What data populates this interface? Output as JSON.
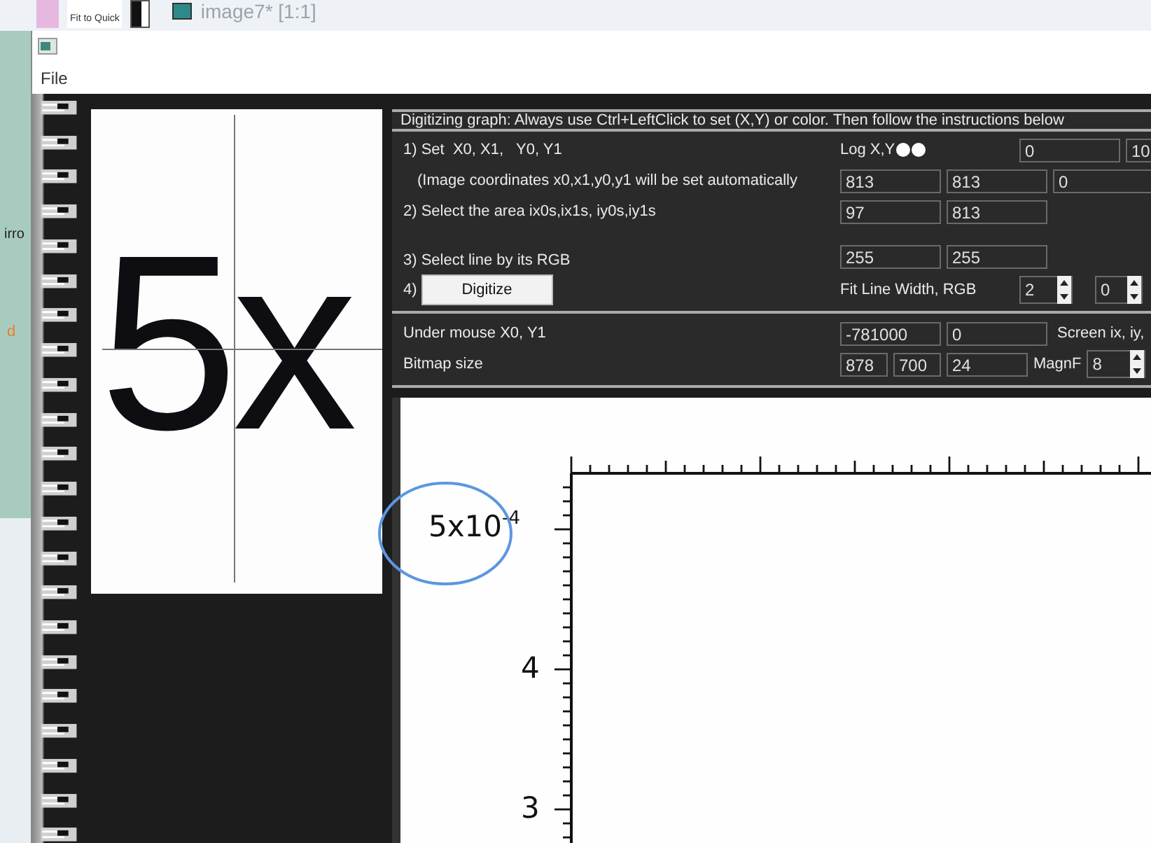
{
  "background_app": {
    "toolbar_button": "Fit to Quick",
    "document_tab": "image7* [1:1]",
    "side_labels": [
      "irro",
      "d"
    ]
  },
  "window": {
    "menu": [
      "File"
    ]
  },
  "magnifier": {
    "text": "5x"
  },
  "instructions": "Digitizing graph: Always use Ctrl+LeftClick to set (X,Y) or color. Then follow the instructions below",
  "step1": {
    "label": "1) Set  X0, X1,   Y0, Y1",
    "log_label": "Log X,Y",
    "log_options": [
      {
        "selected": false
      },
      {
        "selected": false
      }
    ],
    "values": [
      "0",
      "10"
    ]
  },
  "step1_note": {
    "label": "(Image coordinates x0,x1,y0,y1 will be set automatically",
    "values": [
      "813",
      "813",
      "0"
    ]
  },
  "step2": {
    "label": "2) Select the area ix0s,ix1s, iy0s,iy1s",
    "values": [
      "97",
      "813"
    ]
  },
  "step3": {
    "label": "3) Select line by its RGB",
    "values": [
      "255",
      "255"
    ]
  },
  "step4": {
    "label": "4)",
    "button": "Digitize",
    "fit_label": "Fit Line Width, RGB",
    "spinners": [
      "2",
      "0"
    ]
  },
  "mouse": {
    "label": "Under mouse X0, Y1",
    "values": [
      "-781000",
      "0"
    ],
    "screen_label": "Screen ix, iy,"
  },
  "bitmap": {
    "label": "Bitmap size",
    "values": [
      "878",
      "700",
      "24"
    ],
    "magnf_label": "MagnF",
    "magnf": "8"
  },
  "graph": {
    "y_labels": [
      "5x10$^{-4}$",
      "4",
      "3"
    ]
  }
}
